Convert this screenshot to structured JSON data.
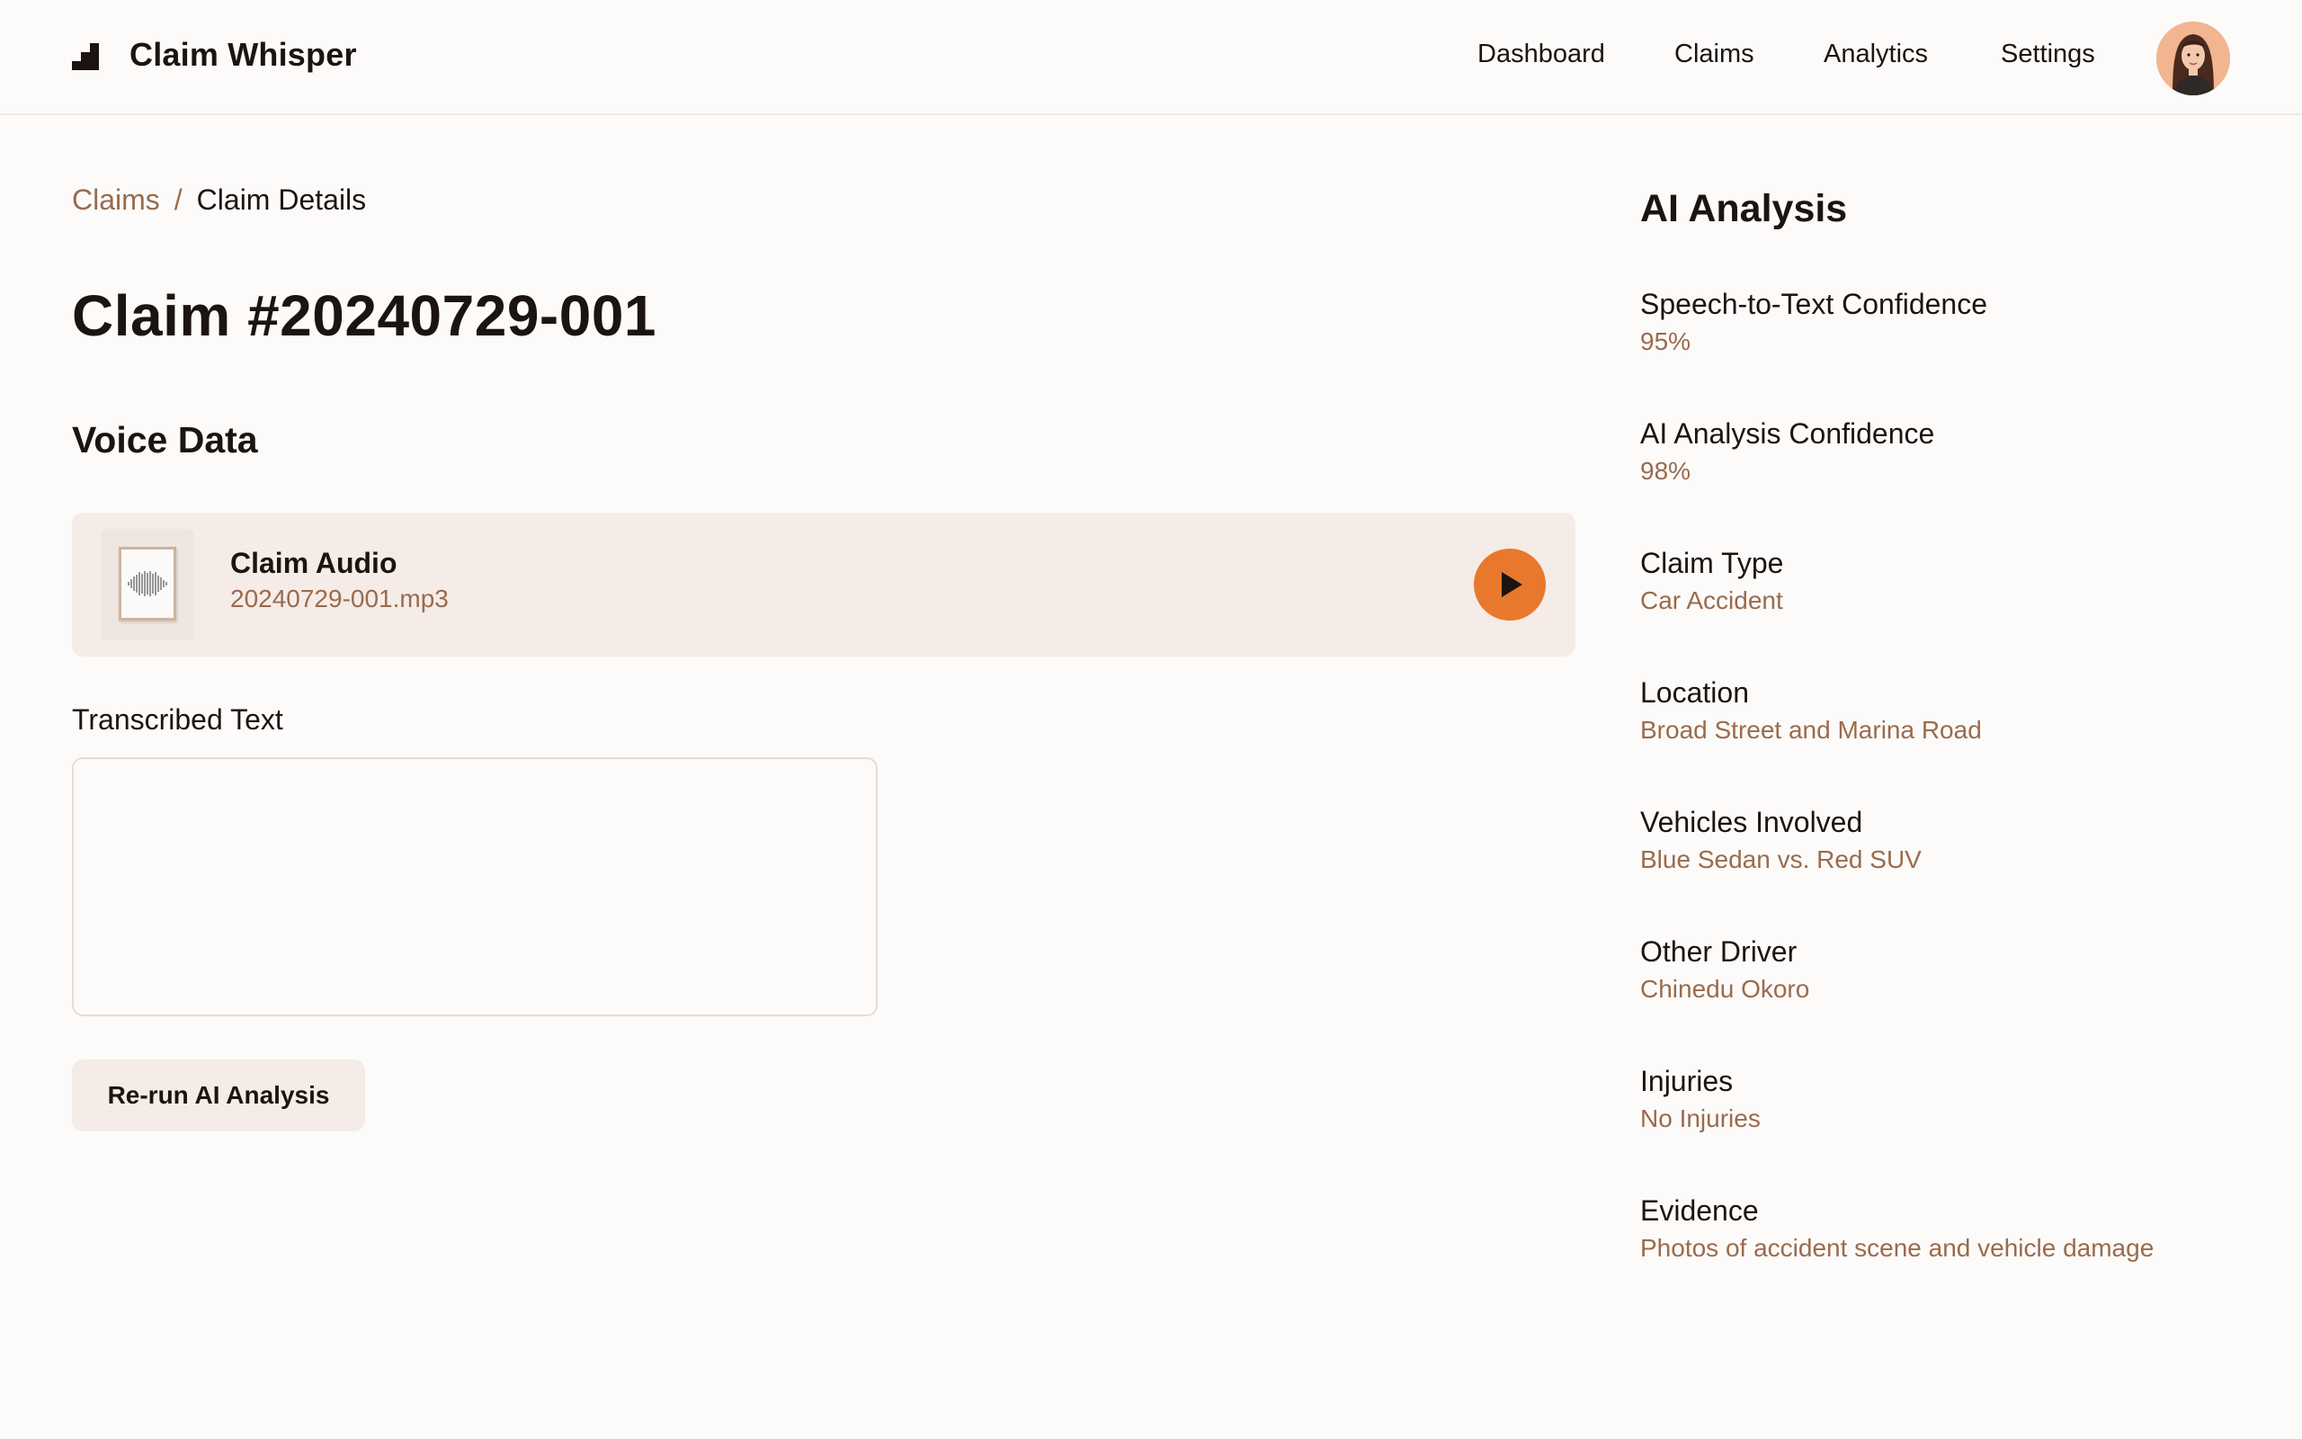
{
  "app": {
    "brand": "Claim Whisper"
  },
  "nav": {
    "dashboard": "Dashboard",
    "claims": "Claims",
    "analytics": "Analytics",
    "settings": "Settings"
  },
  "breadcrumb": {
    "parent": "Claims",
    "separator": "/",
    "current": "Claim Details"
  },
  "claim": {
    "title": "Claim #20240729-001"
  },
  "voice": {
    "section_title": "Voice Data",
    "audio_title": "Claim Audio",
    "audio_file": "20240729-001.mp3",
    "play_icon": "play-icon"
  },
  "transcript": {
    "label": "Transcribed Text",
    "value": ""
  },
  "actions": {
    "rerun_label": "Re-run AI Analysis"
  },
  "analysis": {
    "title": "AI Analysis",
    "items": [
      {
        "label": "Speech-to-Text Confidence",
        "value": "95%"
      },
      {
        "label": "AI Analysis Confidence",
        "value": "98%"
      },
      {
        "label": "Claim Type",
        "value": "Car Accident"
      },
      {
        "label": "Location",
        "value": "Broad Street and Marina Road"
      },
      {
        "label": "Vehicles Involved",
        "value": "Blue Sedan vs. Red SUV"
      },
      {
        "label": "Other Driver",
        "value": "Chinedu Okoro"
      },
      {
        "label": "Injuries",
        "value": "No Injuries"
      },
      {
        "label": "Evidence",
        "value": "Photos of accident scene and vehicle damage"
      }
    ]
  },
  "colors": {
    "accent": "#e8782c",
    "muted_text": "#9a6b4d",
    "card_bg": "#f5ece8",
    "background": "#fcfbfa"
  }
}
